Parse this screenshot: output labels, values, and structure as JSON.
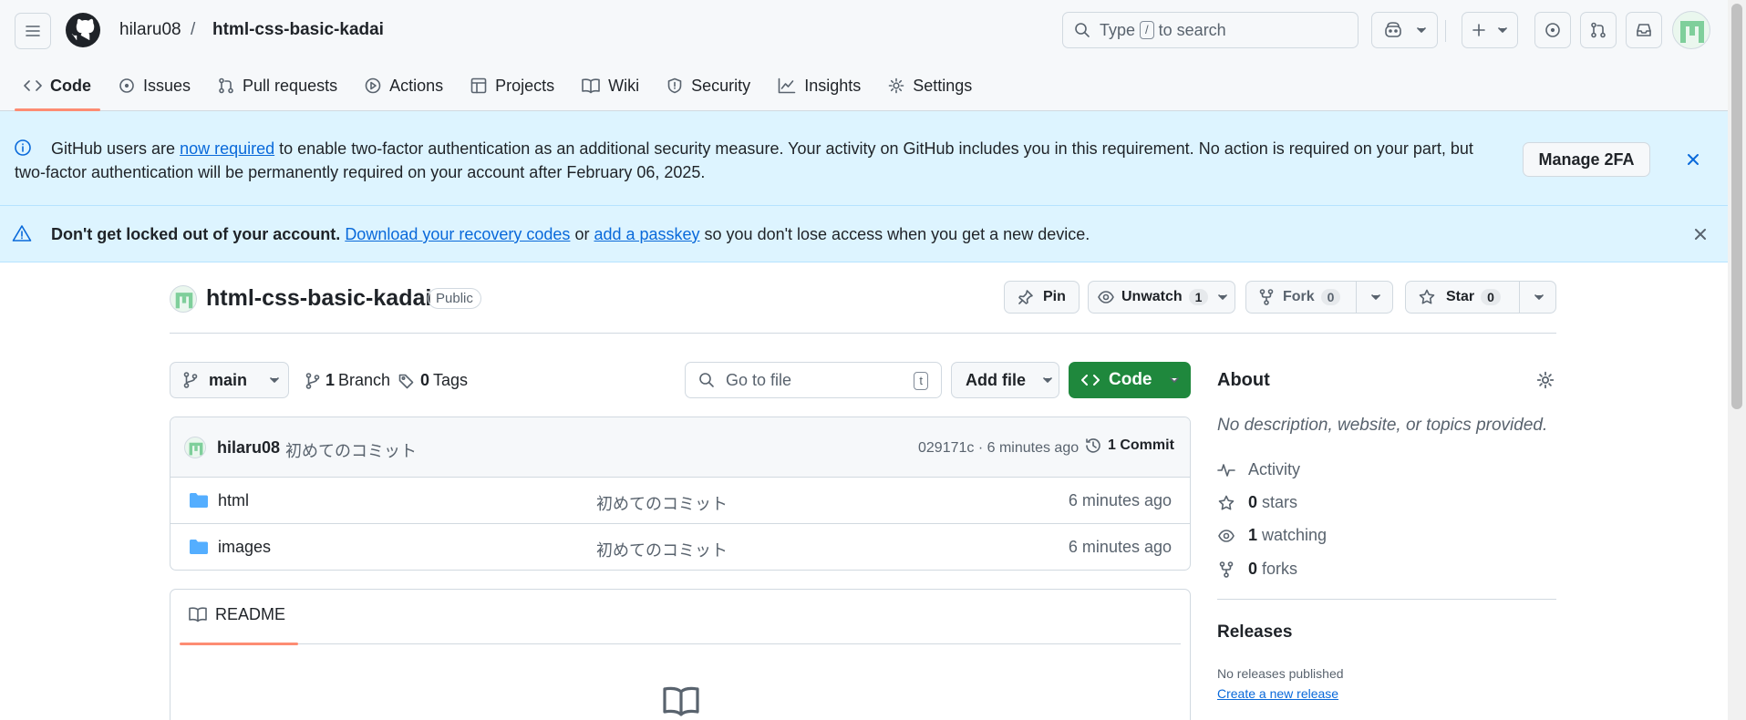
{
  "header": {
    "owner": "hilaru08",
    "separator": "/",
    "repo": "html-css-basic-kadai",
    "search_prefix": "Type",
    "search_key": "/",
    "search_suffix": "to search"
  },
  "tabs": [
    {
      "label": "Code",
      "icon": "code-icon",
      "selected": true
    },
    {
      "label": "Issues",
      "icon": "issue-icon"
    },
    {
      "label": "Pull requests",
      "icon": "pull-request-icon"
    },
    {
      "label": "Actions",
      "icon": "play-icon"
    },
    {
      "label": "Projects",
      "icon": "table-icon"
    },
    {
      "label": "Wiki",
      "icon": "book-icon"
    },
    {
      "label": "Security",
      "icon": "shield-icon"
    },
    {
      "label": "Insights",
      "icon": "graph-icon"
    },
    {
      "label": "Settings",
      "icon": "gear-icon"
    }
  ],
  "banner_2fa": {
    "text_before": "GitHub users are ",
    "link": "now required",
    "text_after": " to enable two-factor authentication as an additional security measure. Your activity on GitHub includes you in this requirement. No action is required on your part, but two-factor authentication will be permanently required on your account after February 06, 2025.",
    "button": "Manage 2FA"
  },
  "banner_recovery": {
    "bold": "Don't get locked out of your account.",
    "link1": "Download your recovery codes",
    "middle": " or ",
    "link2": "add a passkey",
    "after": " so you don't lose access when you get a new device."
  },
  "repo": {
    "name": "html-css-basic-kadai",
    "visibility": "Public",
    "pin": "Pin",
    "unwatch": "Unwatch",
    "watch_count": "1",
    "fork": "Fork",
    "fork_count": "0",
    "star": "Star",
    "star_count": "0"
  },
  "toolbar": {
    "branch": "main",
    "branch_count": "1",
    "branch_label": "Branch",
    "tag_count": "0",
    "tag_label": "Tags",
    "goto_placeholder": "Go to file",
    "goto_key": "t",
    "add_file": "Add file",
    "code": "Code"
  },
  "latest_commit": {
    "author": "hilaru08",
    "message": "初めてのコミット",
    "hash_time": "029171c · 6 minutes ago",
    "commit_count": "1 Commit"
  },
  "files": [
    {
      "name": "html",
      "message": "初めてのコミット",
      "time": "6 minutes ago"
    },
    {
      "name": "images",
      "message": "初めてのコミット",
      "time": "6 minutes ago"
    }
  ],
  "readme": {
    "tab": "README"
  },
  "about": {
    "title": "About",
    "description": "No description, website, or topics provided.",
    "activity": "Activity",
    "stars_count": "0",
    "stars_label": "stars",
    "watching_count": "1",
    "watching_label": "watching",
    "forks_count": "0",
    "forks_label": "forks"
  },
  "releases": {
    "title": "Releases",
    "none": "No releases published",
    "create": "Create a new release"
  },
  "colors": {
    "accent_green": "#1f883d",
    "link_blue": "#0969da",
    "banner_bg": "#ddf4ff",
    "tab_underline": "#fd8c73"
  }
}
